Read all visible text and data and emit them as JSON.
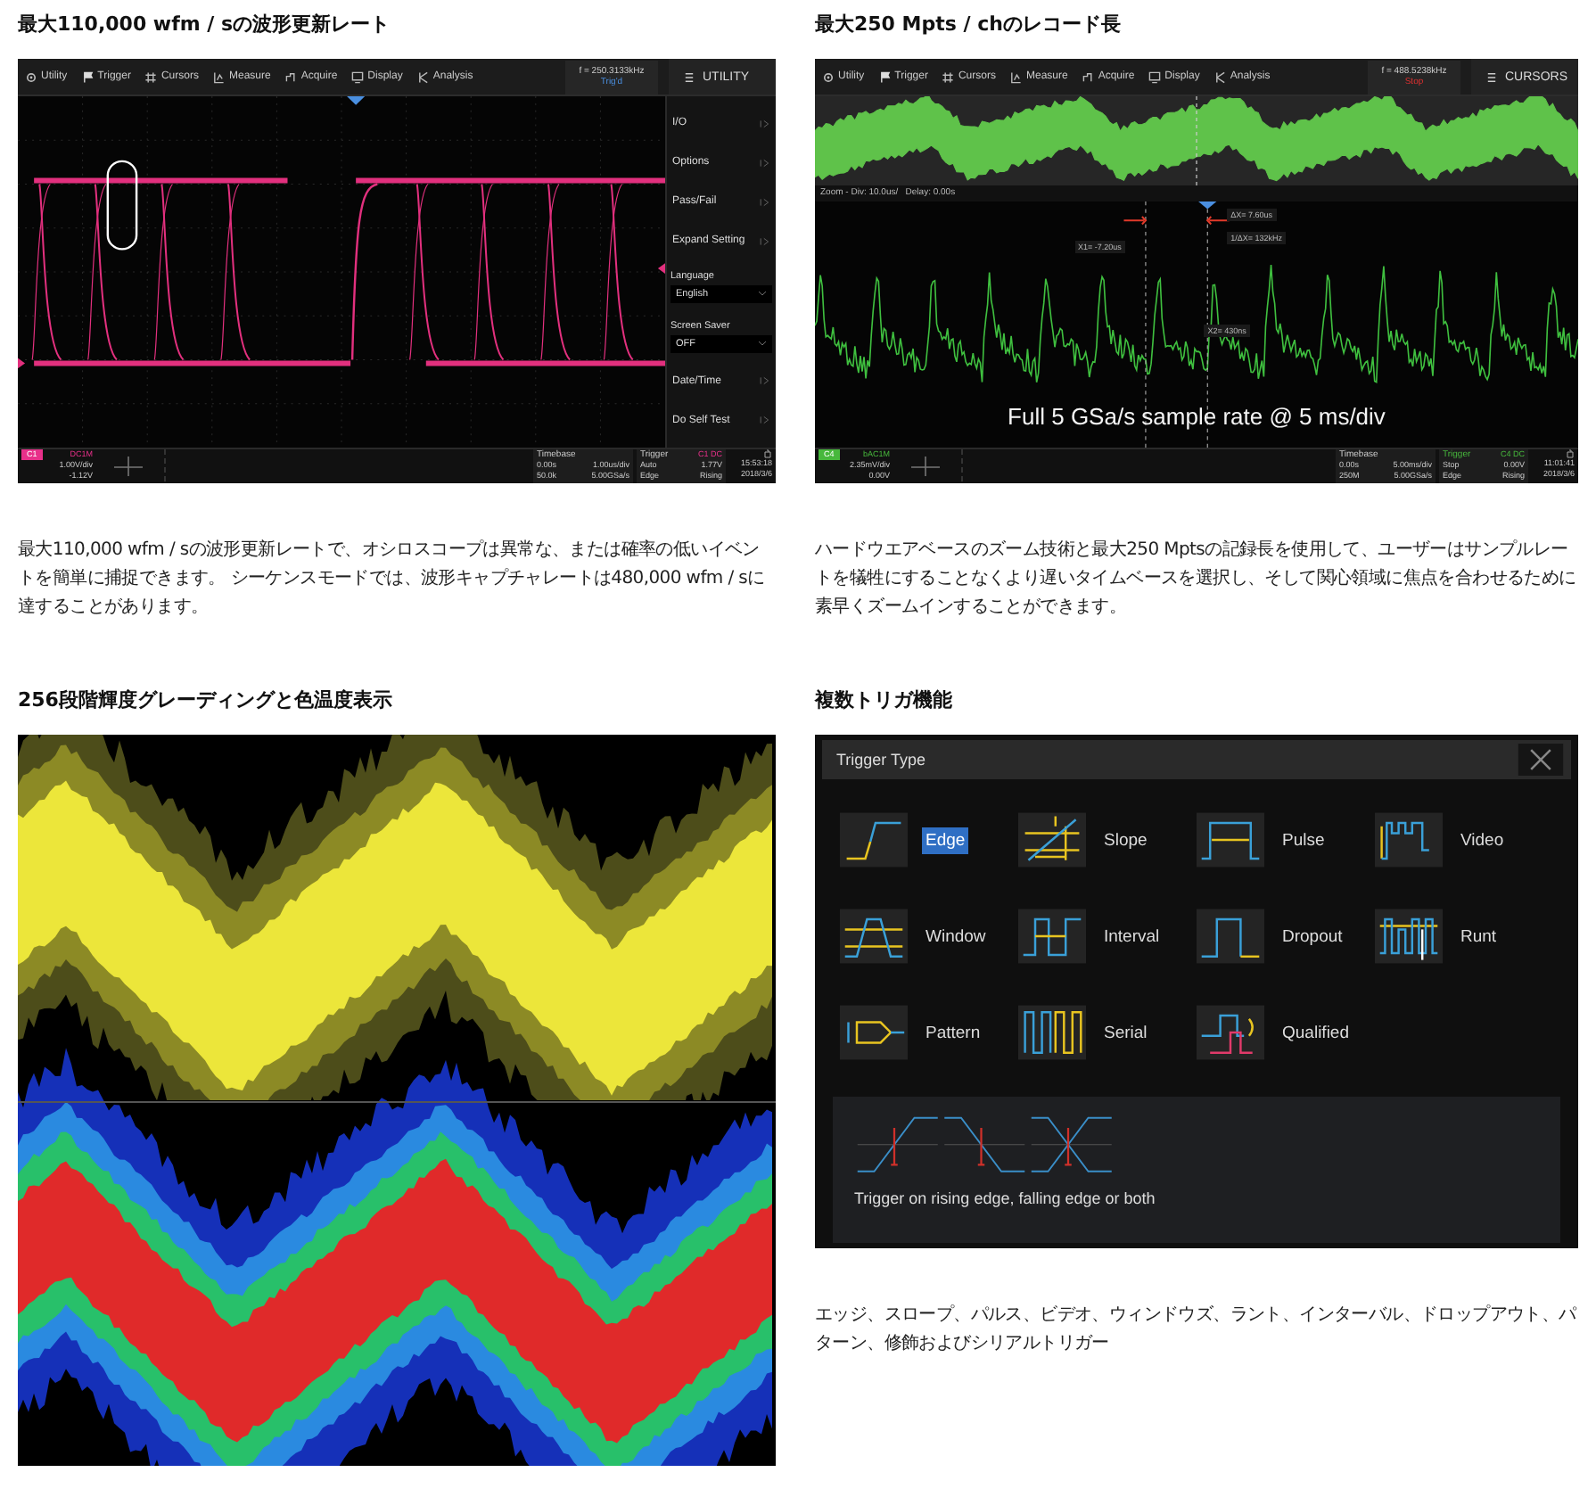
{
  "sections": [
    {
      "kind": "scope",
      "title": "最大110,000 wfm / sの波形更新レート",
      "screen": {
        "menu": [
          "Utility",
          "Trigger",
          "Cursors",
          "Measure",
          "Acquire",
          "Display",
          "Analysis"
        ],
        "frequency": "f = 250.3133kHz",
        "run_status": "Trig'd",
        "stopped": false,
        "panel_title": "UTILITY",
        "menu_items": [
          {
            "kind": "submenu",
            "label": "I/O"
          },
          {
            "kind": "submenu",
            "label": "Options"
          },
          {
            "kind": "submenu",
            "label": "Pass/Fail"
          },
          {
            "kind": "submenu",
            "label": "Expand Setting"
          },
          {
            "kind": "dropdown",
            "label": "Language",
            "value": "English"
          },
          {
            "kind": "dropdown",
            "label": "Screen Saver",
            "value": "OFF"
          },
          {
            "kind": "submenu",
            "label": "Date/Time"
          },
          {
            "kind": "submenu",
            "label": "Do Self Test"
          }
        ],
        "kind": "eye",
        "channel": {
          "label": "C1",
          "coupling": "DC1M",
          "scale": "1.00V/div",
          "offset": "-1.12V",
          "color": "#e8308a"
        },
        "timebase": {
          "title": "Timebase",
          "delay": "0.00s",
          "scale": "1.00us/div",
          "points": "50.0k",
          "rate": "5.00GSa/s"
        },
        "trigger": {
          "title": "Trigger",
          "source": "C1 DC",
          "mode": "Auto",
          "voltage": "1.77V",
          "type": "Edge",
          "slope": "Rising"
        },
        "clock": {
          "time": "15:53:18",
          "date": "2018/3/6"
        }
      },
      "description": "最大110,000 wfm / sの波形更新レートで、オシロスコープは異常な、または確率の低いイベントを簡単に捕捉できます。 シーケンスモードでは、波形キャプチャレートは480,000 wfm / sに達することがあります。"
    },
    {
      "kind": "scope",
      "title": "最大250 Mpts / chのレコード長",
      "screen": {
        "menu": [
          "Utility",
          "Trigger",
          "Cursors",
          "Measure",
          "Acquire",
          "Display",
          "Analysis"
        ],
        "frequency": "f = 488.5238kHz",
        "run_status": "Stop",
        "stopped": true,
        "panel_title": "CURSORS",
        "kind": "zoom",
        "zoom_info": "Zoom - Div: 10.0us/   Delay: 0.00s",
        "cursor_labels": [
          "X1= -7.20us",
          "ΔX= 7.60us",
          "1/ΔX= 132kHz",
          "X2= 430ns"
        ],
        "caption": "Full 5 GSa/s sample rate @ 5 ms/div",
        "channel": {
          "label": "C4",
          "coupling": "bAC1M",
          "scale": "2.35mV/div",
          "offset": "0.00V",
          "color": "#47b83c"
        },
        "timebase": {
          "title": "Timebase",
          "delay": "0.00s",
          "scale": "5.00ms/div",
          "points": "250M",
          "rate": "5.00GSa/s"
        },
        "trigger": {
          "title": "Trigger",
          "source": "C4 DC",
          "mode": "Stop",
          "voltage": "0.00V",
          "type": "Edge",
          "slope": "Rising"
        },
        "clock": {
          "time": "11:01:41",
          "date": "2018/3/6"
        }
      },
      "description": "ハードウエアベースのズーム技術と最大250 Mptsの記録長を使用して、ユーザーはサンプルレートを犠牲にすることなくより遅いタイムベースを選択し、そして関心領域に焦点を合わせるために素早くズームインすることができます。"
    },
    {
      "kind": "grading",
      "title": "256段階輝度グレーディングと色温度表示"
    },
    {
      "kind": "trigger_dialog",
      "title": "複数トリガ機能",
      "dialog": {
        "title": "Trigger Type",
        "types": [
          {
            "label": "Edge",
            "selected": true
          },
          {
            "label": "Slope",
            "selected": false
          },
          {
            "label": "Pulse",
            "selected": false
          },
          {
            "label": "Video",
            "selected": false
          },
          {
            "label": "Window",
            "selected": false
          },
          {
            "label": "Interval",
            "selected": false
          },
          {
            "label": "Dropout",
            "selected": false
          },
          {
            "label": "Runt",
            "selected": false
          },
          {
            "label": "Pattern",
            "selected": false
          },
          {
            "label": "Serial",
            "selected": false
          },
          {
            "label": "Qualified",
            "selected": false
          }
        ],
        "help": "Trigger on rising edge, falling edge or both"
      },
      "description": "エッジ、スロープ、パルス、ビデオ、ウィンドウズ、ラント、インターバル、ドロップアウト、パターン、修飾およびシリアルトリガー"
    }
  ]
}
